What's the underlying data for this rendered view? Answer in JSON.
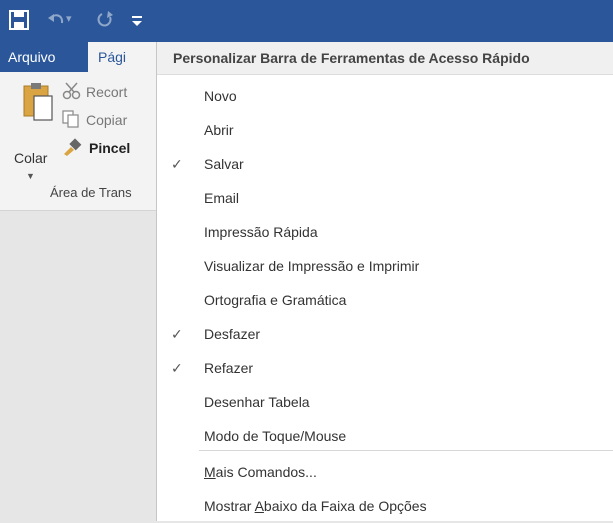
{
  "colors": {
    "accent": "#2b579a",
    "menu_bg": "#ffffff",
    "ribbon_bg": "#f3f3f3"
  },
  "titlebar": {
    "icons": [
      "save-icon",
      "undo-icon",
      "redo-icon",
      "customize-qat-icon"
    ]
  },
  "tabs": {
    "arquivo": "Arquivo",
    "pagina": "Pági"
  },
  "ribbon": {
    "colar": "Colar",
    "recortar": "Recort",
    "copiar": "Copiar",
    "pincel": "Pincel",
    "group": "Área de Trans"
  },
  "menu": {
    "title": "Personalizar Barra de Ferramentas de Acesso Rápido",
    "items": [
      {
        "label": "Novo",
        "checked": false
      },
      {
        "label": "Abrir",
        "checked": false
      },
      {
        "label": "Salvar",
        "checked": true
      },
      {
        "label": "Email",
        "checked": false
      },
      {
        "label": "Impressão Rápida",
        "checked": false
      },
      {
        "label": "Visualizar de Impressão e Imprimir",
        "checked": false
      },
      {
        "label": "Ortografia e Gramática",
        "checked": false
      },
      {
        "label": "Desfazer",
        "checked": true
      },
      {
        "label": "Refazer",
        "checked": true
      },
      {
        "label": "Desenhar Tabela",
        "checked": false
      },
      {
        "label": "Modo de Toque/Mouse",
        "checked": false
      }
    ],
    "more_commands": {
      "prefix": "",
      "underlined": "M",
      "rest": "ais Comandos..."
    },
    "show_below": {
      "prefix": "Mostrar ",
      "underlined": "A",
      "rest": "baixo da Faixa de Opções"
    },
    "check_mark": "✓"
  }
}
